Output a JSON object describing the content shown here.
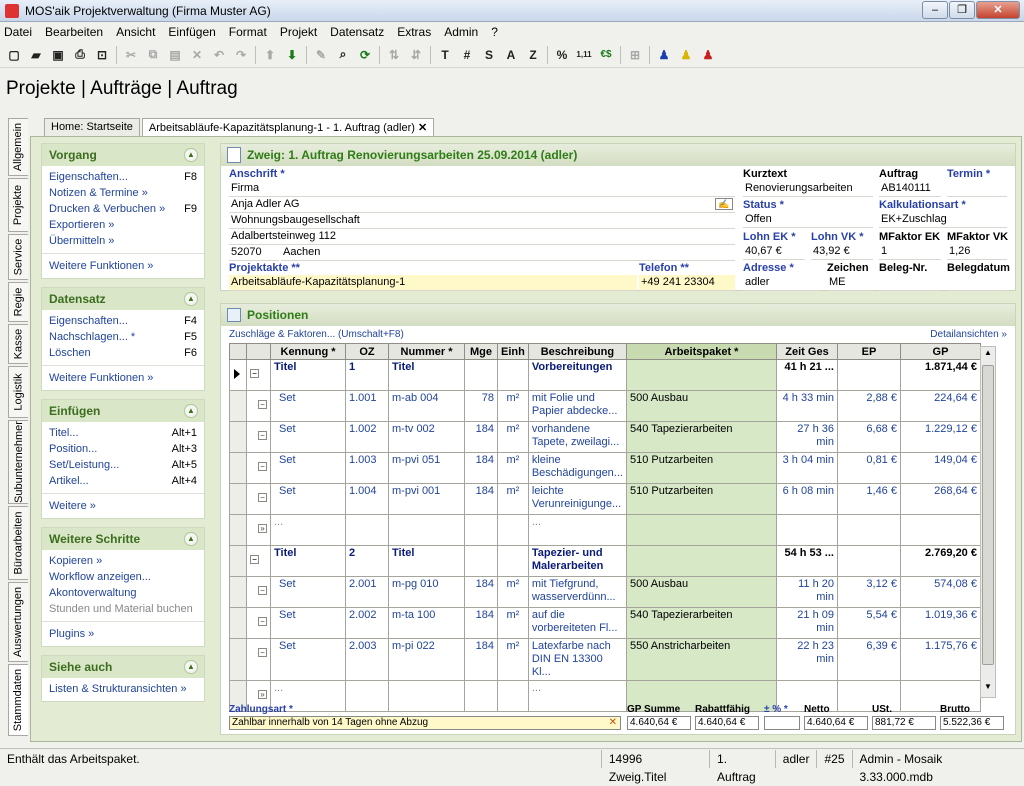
{
  "window": {
    "title": "MOS'aik Projektverwaltung (Firma Muster AG)"
  },
  "menu": [
    "Datei",
    "Bearbeiten",
    "Ansicht",
    "Einfügen",
    "Format",
    "Projekt",
    "Datensatz",
    "Extras",
    "Admin",
    "?"
  ],
  "toolbar_text": {
    "t": "T",
    "hash": "#",
    "s": "S",
    "a": "A",
    "z": "Z",
    "pct": "%",
    "prec": "1,11",
    "euro": "€$"
  },
  "breadcrumb": "Projekte | Aufträge | Auftrag",
  "vtabs": [
    "Allgemein",
    "Projekte",
    "Service",
    "Regie",
    "Kasse",
    "Logistik",
    "Subunternehmer",
    "Büroarbeiten",
    "Auswertungen",
    "Stammdaten"
  ],
  "doctabs": {
    "home": "Home: Startseite",
    "active": "Arbeitsabläufe-Kapazitätsplanung-1 - 1. Auftrag (adler)"
  },
  "side": {
    "vorgang": {
      "title": "Vorgang",
      "items": [
        {
          "label": "Eigenschaften...",
          "key": "F8"
        },
        {
          "label": "Notizen & Termine »",
          "key": ""
        },
        {
          "label": "Drucken & Verbuchen »",
          "key": "F9"
        },
        {
          "label": "Exportieren »",
          "key": ""
        },
        {
          "label": "Übermitteln »",
          "key": ""
        }
      ],
      "more": "Weitere Funktionen »"
    },
    "datensatz": {
      "title": "Datensatz",
      "items": [
        {
          "label": "Eigenschaften...",
          "key": "F4"
        },
        {
          "label": "Nachschlagen... *",
          "key": "F5"
        },
        {
          "label": "Löschen",
          "key": "F6"
        }
      ],
      "more": "Weitere Funktionen »"
    },
    "einfuegen": {
      "title": "Einfügen",
      "items": [
        {
          "label": "Titel...",
          "key": "Alt+1"
        },
        {
          "label": "Position...",
          "key": "Alt+3"
        },
        {
          "label": "Set/Leistung...",
          "key": "Alt+5"
        },
        {
          "label": "Artikel...",
          "key": "Alt+4"
        }
      ],
      "more": "Weitere »"
    },
    "schritte": {
      "title": "Weitere Schritte",
      "items": [
        {
          "label": "Kopieren »",
          "key": ""
        },
        {
          "label": "Workflow anzeigen...",
          "key": ""
        },
        {
          "label": "Akontoverwaltung",
          "key": ""
        },
        {
          "label": "Stunden und Material buchen",
          "key": ""
        }
      ],
      "more": "Plugins »"
    },
    "siehe": {
      "title": "Siehe auch",
      "items": [
        {
          "label": "Listen & Strukturansichten »",
          "key": ""
        }
      ]
    }
  },
  "zweig": {
    "title": "Zweig: 1. Auftrag Renovierungsarbeiten 25.09.2014 (adler)",
    "anschrift_label": "Anschrift *",
    "anrede": "Firma",
    "name": "Anja Adler AG",
    "firma": "Wohnungsbaugesellschaft",
    "strasse": "Adalbertsteinweg 112",
    "plz": "52070",
    "ort": "Aachen",
    "projektakte_label": "Projektakte **",
    "projektakte": "Arbeitsabläufe-Kapazitätsplanung-1",
    "telefon_label": "Telefon **",
    "telefon": "+49 241 23304",
    "kurztext_label": "Kurztext",
    "kurztext": "Renovierungsarbeiten",
    "auftrag_label": "Auftrag",
    "auftrag": "AB140111",
    "termin_label": "Termin *",
    "termin": "",
    "status_label": "Status *",
    "status": "Offen",
    "kalk_label": "Kalkulationsart *",
    "kalk": "EK+Zuschlag",
    "lohnek_label": "Lohn EK *",
    "lohnek": "40,67 €",
    "lohnvk_label": "Lohn VK *",
    "lohnvk": "43,92 €",
    "mfek_label": "MFaktor EK",
    "mfek": "1",
    "mfvk_label": "MFaktor VK",
    "mfvk": "1,26",
    "adresse_label": "Adresse *",
    "adresse": "adler",
    "zeichen_label": "Zeichen",
    "zeichen": "ME",
    "belegnr_label": "Beleg-Nr.",
    "belegnr": "",
    "belegdatum_label": "Belegdatum",
    "belegdatum": ""
  },
  "positionen": {
    "title": "Positionen",
    "link_left": "Zuschläge & Faktoren... (Umschalt+F8)",
    "link_right": "Detailansichten »",
    "columns": [
      "Kennung *",
      "OZ",
      "Nummer *",
      "Mge",
      "Einh",
      "Beschreibung",
      "Arbeitspaket *",
      "Zeit Ges",
      "EP",
      "GP"
    ],
    "rows": [
      {
        "type": "titel",
        "kennung": "Titel",
        "oz": "1",
        "nummer": "Titel",
        "mge": "",
        "einh": "",
        "beschreibung": "Vorbereitungen",
        "ap": "",
        "zeit": "41 h 21 ...",
        "ep": "",
        "gp": "1.871,44 €"
      },
      {
        "type": "set",
        "kennung": "Set",
        "oz": "1.001",
        "nummer": "m-ab 004",
        "mge": "78",
        "einh": "m²",
        "beschreibung": "mit Folie und Papier abdecke...",
        "ap": "500 Ausbau",
        "zeit": "4 h 33 min",
        "ep": "2,88 €",
        "gp": "224,64 €"
      },
      {
        "type": "set",
        "kennung": "Set",
        "oz": "1.002",
        "nummer": "m-tv 002",
        "mge": "184",
        "einh": "m²",
        "beschreibung": "vorhandene Tapete, zweilagi...",
        "ap": "540 Tapezierarbeiten",
        "zeit": "27 h 36 min",
        "ep": "6,68 €",
        "gp": "1.229,12 €"
      },
      {
        "type": "set",
        "kennung": "Set",
        "oz": "1.003",
        "nummer": "m-pvi 051",
        "mge": "184",
        "einh": "m²",
        "beschreibung": "kleine Beschädigungen...",
        "ap": "510 Putzarbeiten",
        "zeit": "3 h 04 min",
        "ep": "0,81 €",
        "gp": "149,04 €"
      },
      {
        "type": "set",
        "kennung": "Set",
        "oz": "1.004",
        "nummer": "m-pvi 001",
        "mge": "184",
        "einh": "m²",
        "beschreibung": "leichte Verunreinigunge...",
        "ap": "510 Putzarbeiten",
        "zeit": "6 h 08 min",
        "ep": "1,46 €",
        "gp": "268,64 €"
      },
      {
        "type": "empty",
        "kennung": "...",
        "oz": "",
        "nummer": "",
        "mge": "",
        "einh": "",
        "beschreibung": "...",
        "ap": "",
        "zeit": "",
        "ep": "",
        "gp": ""
      },
      {
        "type": "titel",
        "kennung": "Titel",
        "oz": "2",
        "nummer": "Titel",
        "mge": "",
        "einh": "",
        "beschreibung": "Tapezier- und Malerarbeiten",
        "ap": "",
        "zeit": "54 h 53 ...",
        "ep": "",
        "gp": "2.769,20 €"
      },
      {
        "type": "set",
        "kennung": "Set",
        "oz": "2.001",
        "nummer": "m-pg 010",
        "mge": "184",
        "einh": "m²",
        "beschreibung": "mit Tiefgrund, wasserverdünn...",
        "ap": "500 Ausbau",
        "zeit": "11 h 20 min",
        "ep": "3,12 €",
        "gp": "574,08 €"
      },
      {
        "type": "set",
        "kennung": "Set",
        "oz": "2.002",
        "nummer": "m-ta 100",
        "mge": "184",
        "einh": "m²",
        "beschreibung": "auf die vorbereiteten Fl...",
        "ap": "540 Tapezierarbeiten",
        "zeit": "21 h 09 min",
        "ep": "5,54 €",
        "gp": "1.019,36 €"
      },
      {
        "type": "set",
        "kennung": "Set",
        "oz": "2.003",
        "nummer": "m-pi 022",
        "mge": "184",
        "einh": "m²",
        "beschreibung": "Latexfarbe nach DIN EN 13300 Kl...",
        "ap": "550 Anstricharbeiten",
        "zeit": "22 h 23 min",
        "ep": "6,39 €",
        "gp": "1.175,76 €"
      },
      {
        "type": "empty",
        "kennung": "...",
        "oz": "",
        "nummer": "",
        "mge": "",
        "einh": "",
        "beschreibung": "...",
        "ap": "",
        "zeit": "",
        "ep": "",
        "gp": ""
      }
    ]
  },
  "footer": {
    "zahlungsart_label": "Zahlungsart *",
    "zahlungsart": "Zahlbar innerhalb von 14 Tagen ohne Abzug",
    "gpsumme_label": "GP Summe",
    "gpsumme": "4.640,64 €",
    "rabatt_label": "Rabattfähig",
    "rabatt": "4.640,64 €",
    "pct_label": "± % *",
    "pct": "",
    "netto_label": "Netto",
    "netto": "4.640,64 €",
    "ust_label": "USt.",
    "ust": "881,72 €",
    "brutto_label": "Brutto",
    "brutto": "5.522,36 €"
  },
  "status": {
    "message": "Enthält das Arbeitspaket.",
    "zweig": "14996 Zweig.Titel",
    "auftrag": "1. Auftrag",
    "user": "adler",
    "nr": "#25",
    "db": "Admin - Mosaik 3.33.000.mdb"
  }
}
